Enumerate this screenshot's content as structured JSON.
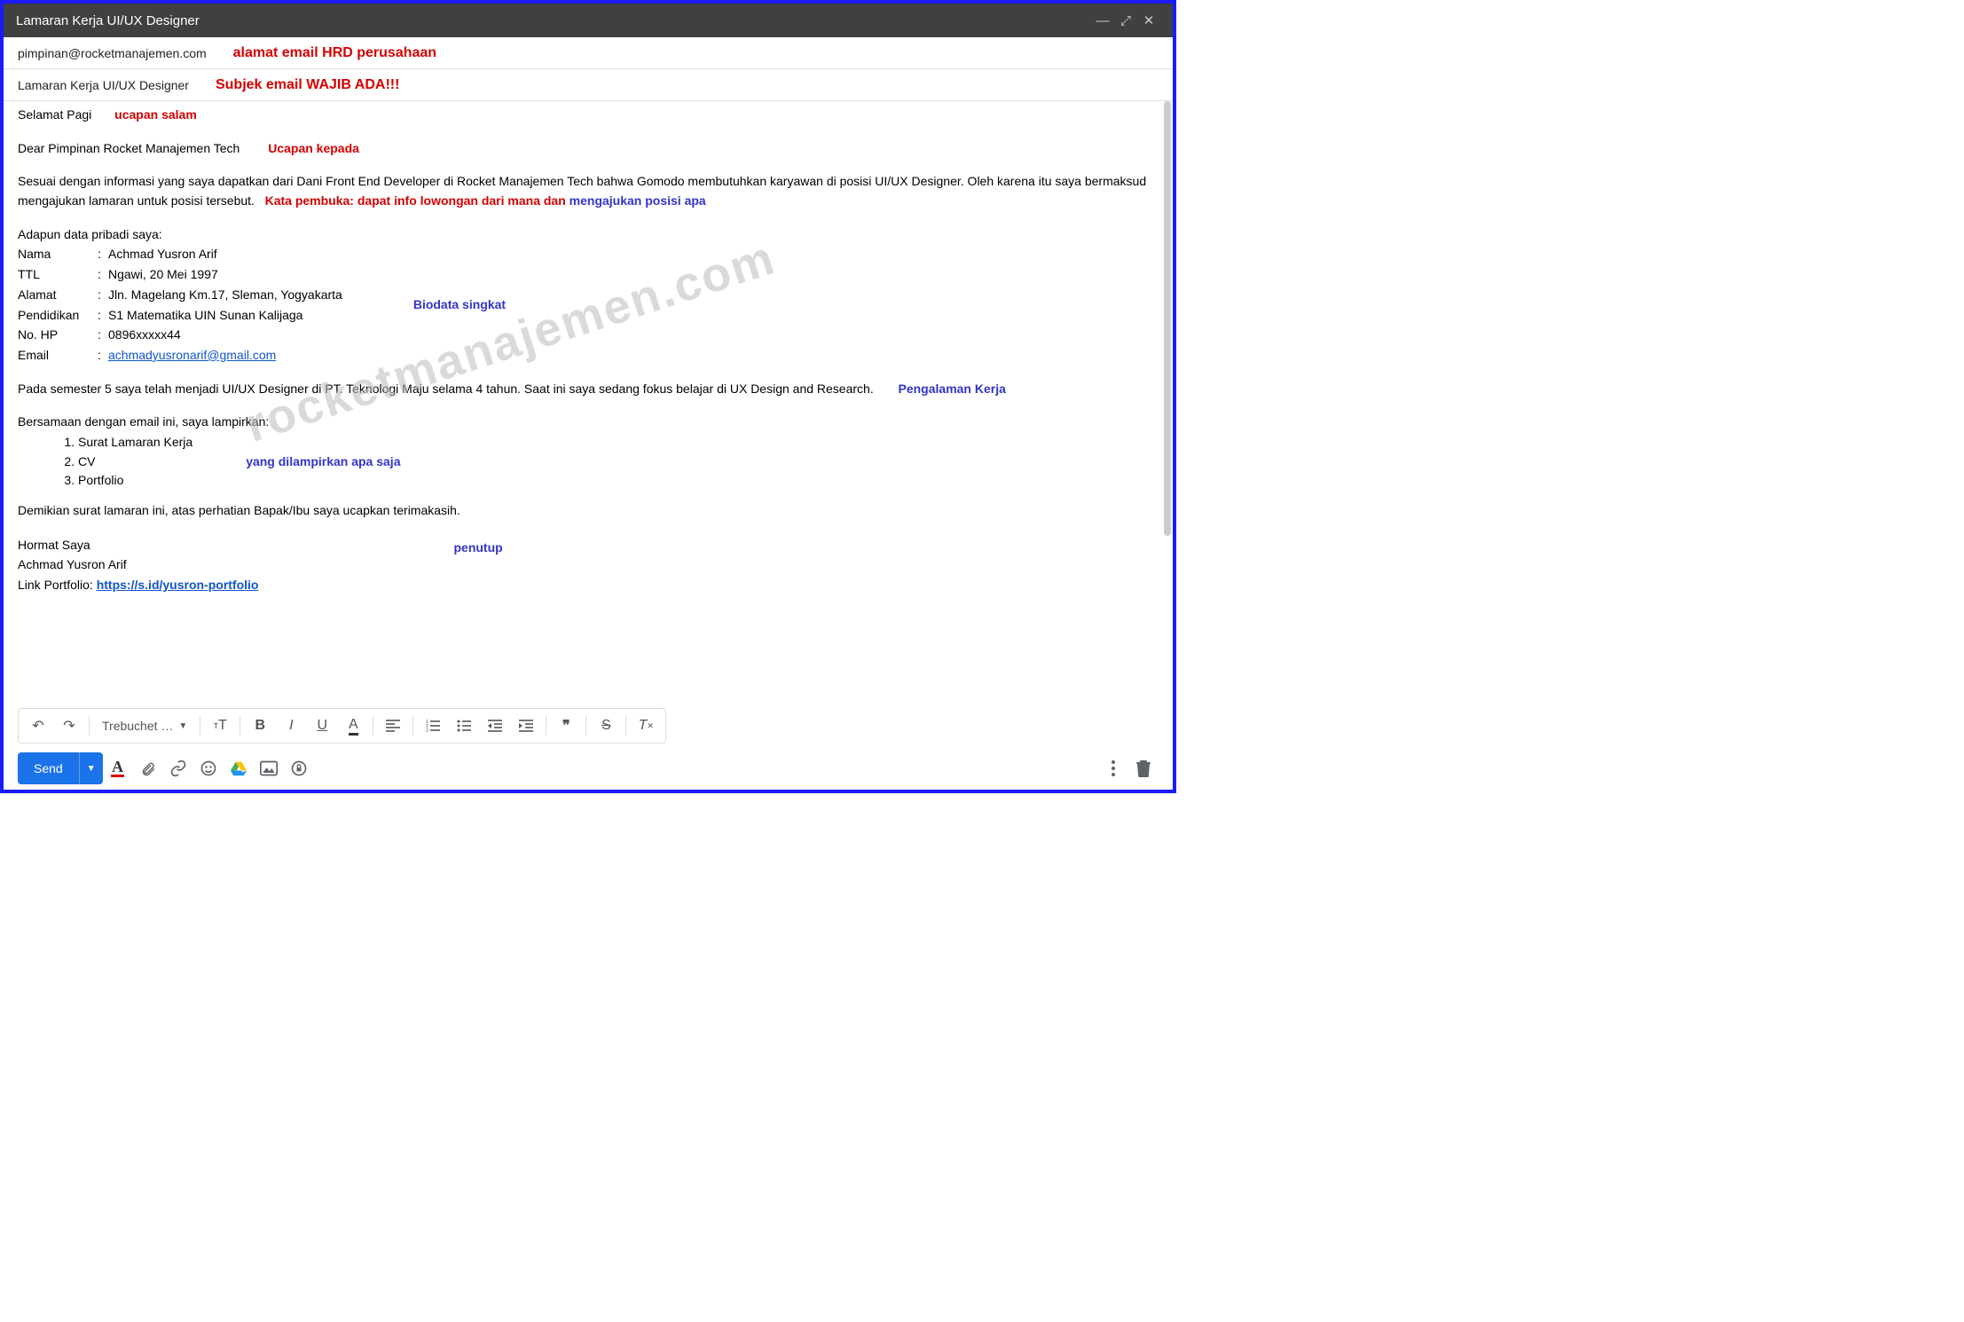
{
  "titlebar": {
    "title": "Lamaran Kerja UI/UX Designer"
  },
  "recipient": {
    "email": "pimpinan@rocketmanajemen.com",
    "annotation": "alamat email HRD perusahaan"
  },
  "subject": {
    "text": "Lamaran Kerja UI/UX Designer",
    "annotation": "Subjek email WAJIB ADA!!!"
  },
  "body": {
    "greeting": "Selamat Pagi",
    "greeting_ann": "ucapan salam",
    "dear": "Dear Pimpinan Rocket Manajemen Tech",
    "dear_ann": "Ucapan kepada",
    "intro_a": "Sesuai dengan informasi yang saya dapatkan dari Dani Front End Developer di Rocket Manajemen Tech bahwa Gomodo membutuhkan karyawan di posisi UI/UX Designer. Oleh karena itu saya bermaksud mengajukan lamaran untuk posisi tersebut.",
    "intro_ann_red": "Kata pembuka: dapat info lowongan dari mana dan ",
    "intro_ann_blue": "mengajukan posisi apa",
    "biodata_title": "Adapun data pribadi saya:",
    "bio": {
      "nama_l": "Nama",
      "nama_v": "Achmad Yusron Arif",
      "ttl_l": "TTL",
      "ttl_v": "Ngawi, 20 Mei 1997",
      "alamat_l": "Alamat",
      "alamat_v": "Jln. Magelang Km.17, Sleman, Yogyakarta",
      "pend_l": "Pendidikan",
      "pend_v": "S1 Matematika UIN Sunan Kalijaga",
      "hp_l": "No. HP",
      "hp_v": "0896xxxxx44",
      "email_l": "Email",
      "email_v": "achmadyusronarif@gmail.com"
    },
    "bio_ann": "Biodata singkat",
    "experience": "Pada semester 5 saya telah menjadi UI/UX Designer di PT. Teknologi Maju selama 4 tahun. Saat ini saya sedang fokus belajar di UX Design and Research.",
    "experience_ann": "Pengalaman Kerja",
    "attach_intro": "Bersamaan dengan email ini, saya lampirkan:",
    "attach_items": [
      "Surat Lamaran Kerja",
      "CV",
      "Portfolio"
    ],
    "attach_ann": "yang dilampirkan apa saja",
    "closing": "Demikian surat lamaran ini, atas perhatian Bapak/Ibu saya ucapkan terimakasih.",
    "sign1": "Hormat Saya",
    "sign2": "Achmad Yusron Arif",
    "portfolio_label": "Link Portfolio: ",
    "portfolio_link": "https://s.id/yusron-portfolio",
    "closing_ann": "penutup"
  },
  "watermark": "rocketmanajemen.com",
  "toolbar": {
    "font": "Trebuchet … "
  },
  "footer": {
    "send": "Send"
  }
}
